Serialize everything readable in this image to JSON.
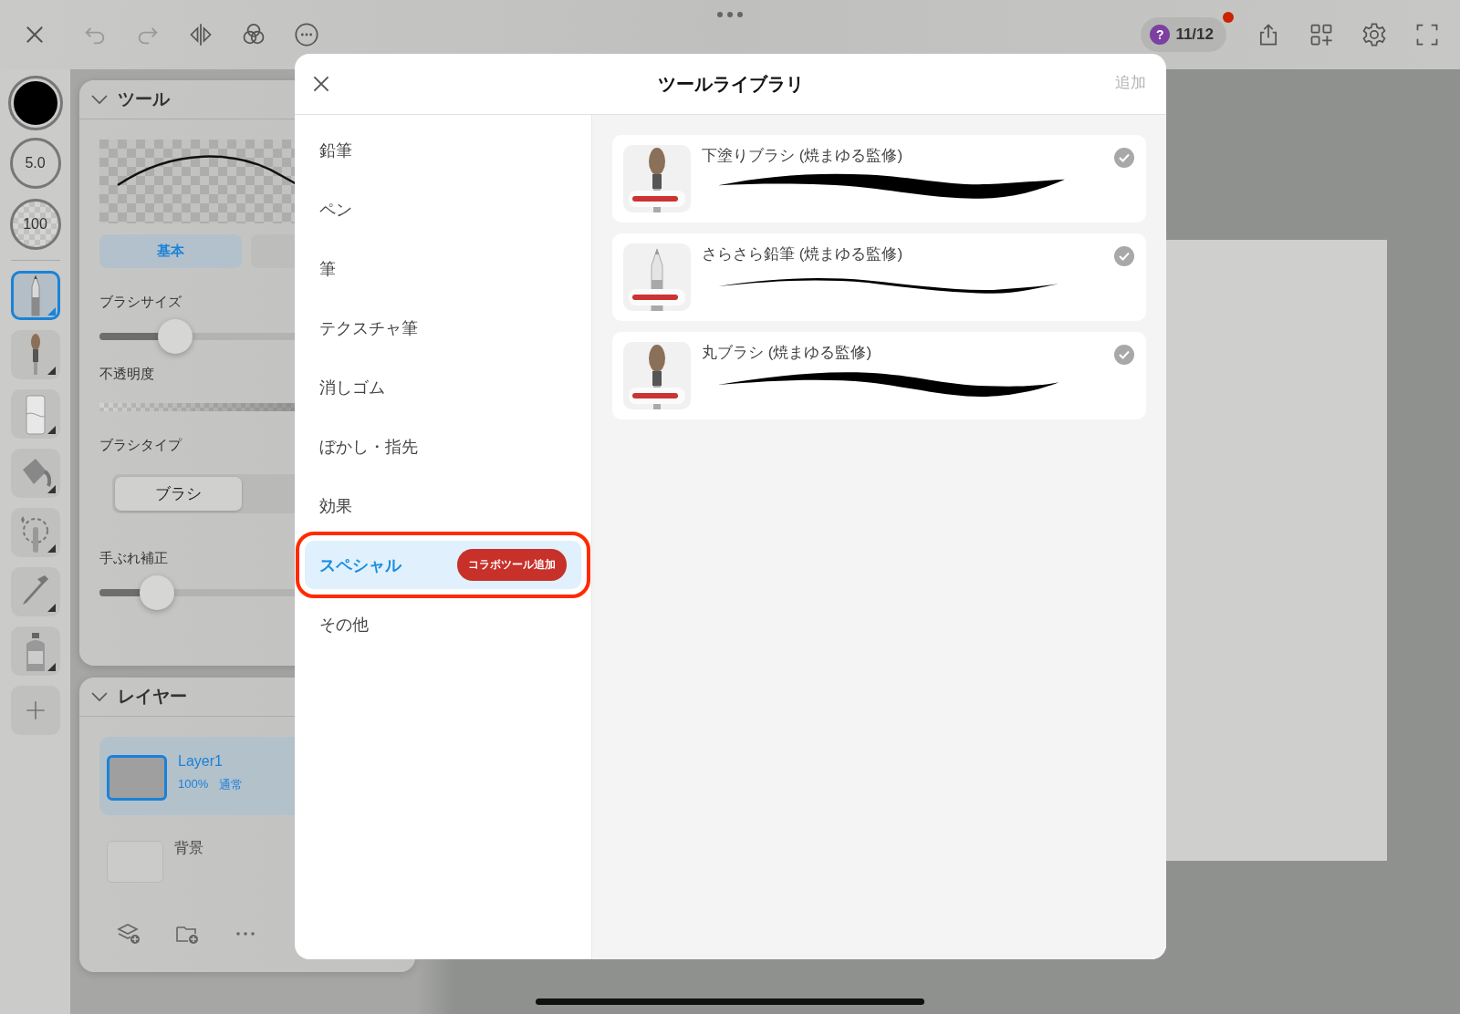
{
  "top_bar": {
    "help_glyph": "?",
    "notice_count": "11/12",
    "has_notification": true
  },
  "rail": {
    "brush_size": "5.0",
    "opacity": "100",
    "tools": [
      {
        "kind": "pencil",
        "selected": true
      },
      {
        "kind": "brush",
        "selected": false
      },
      {
        "kind": "eraser",
        "selected": false
      },
      {
        "kind": "bucket",
        "selected": false
      },
      {
        "kind": "wand",
        "selected": false
      },
      {
        "kind": "dropper",
        "selected": false
      },
      {
        "kind": "spray",
        "selected": false
      }
    ]
  },
  "tool_panel": {
    "title": "ツール",
    "tabs": [
      {
        "label": "基本",
        "selected": true
      }
    ],
    "brush_size": {
      "label": "ブラシサイズ",
      "level": 0.25
    },
    "opacity": {
      "label": "不透明度",
      "level": 1
    },
    "brush_type": {
      "label": "ブラシタイプ",
      "options": [
        {
          "label": "ブラシ",
          "selected": true
        }
      ]
    },
    "stabilizer": {
      "label": "手ぶれ補正",
      "level": 0.19
    }
  },
  "layer_panel": {
    "title": "レイヤー",
    "layers": [
      {
        "name": "Layer1",
        "opacity": "100%",
        "blend": "通常",
        "selected": true
      },
      {
        "name": "背景",
        "selected": false
      }
    ]
  },
  "dialog": {
    "title": "ツールライブラリ",
    "add_button": {
      "label": "追加",
      "disabled": true
    },
    "categories": [
      {
        "label": "鉛筆",
        "selected": false
      },
      {
        "label": "ペン",
        "selected": false
      },
      {
        "label": "筆",
        "selected": false
      },
      {
        "label": "テクスチャ筆",
        "selected": false
      },
      {
        "label": "消しゴム",
        "selected": false
      },
      {
        "label": "ぼかし・指先",
        "selected": false
      },
      {
        "label": "効果",
        "selected": false
      },
      {
        "label": "スペシャル",
        "selected": true,
        "highlighted": true,
        "badge": "コラボツール追加"
      },
      {
        "label": "その他",
        "selected": false
      }
    ],
    "brushes": [
      {
        "name": "下塗りブラシ (焼まゆる監修)",
        "kind": "flat",
        "checked": true
      },
      {
        "name": "さらさら鉛筆 (焼まゆる監修)",
        "kind": "pencil",
        "checked": true
      },
      {
        "name": "丸ブラシ (焼まゆる監修)",
        "kind": "round",
        "checked": true
      }
    ]
  }
}
